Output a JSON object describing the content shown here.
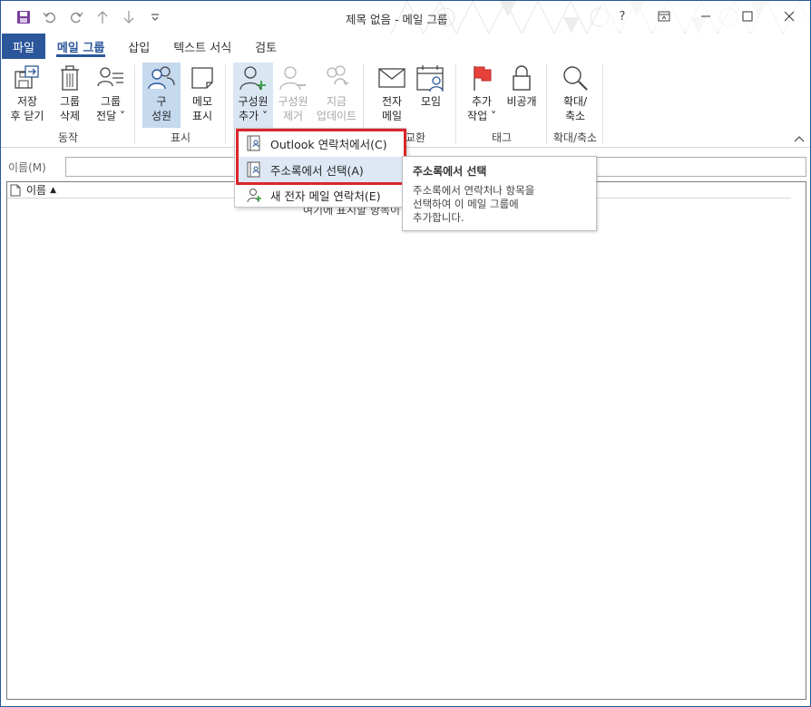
{
  "window": {
    "title": "제목 없음  -  메일 그룹"
  },
  "quick_access": [
    {
      "name": "save-icon"
    },
    {
      "name": "undo-icon"
    },
    {
      "name": "redo-icon"
    },
    {
      "name": "arrow-up-icon"
    },
    {
      "name": "arrow-down-icon"
    },
    {
      "name": "customize-qat-icon"
    }
  ],
  "window_controls": {
    "help": "?",
    "ribbon_display": "ribbon-display-icon",
    "minimize": "minimize-icon",
    "maximize": "maximize-icon",
    "close": "close-icon"
  },
  "tabs": [
    {
      "label": "파일"
    },
    {
      "label": "메일 그룹"
    },
    {
      "label": "삽입"
    },
    {
      "label": "텍스트 서식"
    },
    {
      "label": "검토"
    }
  ],
  "ribbon": {
    "groups": {
      "actions": {
        "label": "동작",
        "save_close_1": "저장",
        "save_close_2": "후 닫기",
        "delete_1": "그룹",
        "delete_2": "삭제",
        "forward_1": "그룹",
        "forward_2": "전달"
      },
      "show": {
        "label": "표시",
        "members_1": "구",
        "members_2": "성원",
        "notes_1": "메모",
        "notes_2": "표시"
      },
      "members": {
        "add_1": "구성원",
        "add_2": "추가",
        "remove_1": "구성원",
        "remove_2": "제거",
        "update_1": "지금",
        "update_2": "업데이트"
      },
      "communicate": {
        "label": "교환",
        "email_1": "전자",
        "email_2": "메일",
        "meeting": "모임"
      },
      "tags": {
        "label": "태그",
        "followup_1": "추가",
        "followup_2": "작업",
        "private": "비공개"
      },
      "zoom": {
        "label": "확대/축소",
        "zoom_1": "확대/",
        "zoom_2": "축소"
      }
    }
  },
  "form": {
    "name_label": "이름(M)",
    "name_value": ""
  },
  "list": {
    "column_name": "이름",
    "hint": "여기에 표시할 항목이"
  },
  "dropdown": {
    "items": [
      {
        "label": "Outlook 연락처에서(C)"
      },
      {
        "label": "주소록에서 선택(A)"
      },
      {
        "label": "새 전자 메일 연락처(E)"
      }
    ]
  },
  "tooltip": {
    "title": "주소록에서 선택",
    "body": "주소록에서 연락처나 항목을\n선택하여 이 메일 그룹에\n추가합니다."
  },
  "colors": {
    "accent": "#2b579a",
    "highlight": "#d9262b",
    "members_selected": "#c5d9ef",
    "flag": "#e8413b"
  }
}
